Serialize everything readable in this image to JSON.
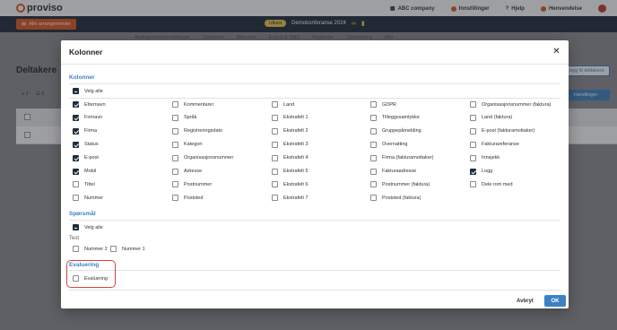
{
  "topbar": {
    "logo_text": "proviso",
    "company": "ABC company",
    "settings": "Innstillinger",
    "help": "Hjelp",
    "user": "Henvendelse"
  },
  "eventbar": {
    "all_events": "Alle arrangementer",
    "status": "Utkast",
    "event_name": "Demokonferanse 2024"
  },
  "tabs": [
    "Arrangementsinnstillinger",
    "Deltakere",
    "Økonomi",
    "E-post & SMS",
    "Rapporter",
    "Overnatting",
    "Mer"
  ],
  "page": {
    "title": "Deltakere",
    "add_button": "Legg til deltakere",
    "actions_button": "Handlinger",
    "filter_count": "1",
    "column_count": "0"
  },
  "modal": {
    "title": "Kolonner",
    "sections": {
      "columns": {
        "title": "Kolonner",
        "select_all": "Velg alle",
        "items": [
          {
            "label": "Etternavn",
            "checked": true
          },
          {
            "label": "Fornavn",
            "checked": true
          },
          {
            "label": "Firma",
            "checked": true
          },
          {
            "label": "Status",
            "checked": true
          },
          {
            "label": "E-post",
            "checked": true
          },
          {
            "label": "Mobil",
            "checked": true
          },
          {
            "label": "Tittel",
            "checked": false
          },
          {
            "label": "Nummer",
            "checked": false
          },
          {
            "label": "Kommentarer",
            "checked": false
          },
          {
            "label": "Språk",
            "checked": false
          },
          {
            "label": "Registreringsdato",
            "checked": false
          },
          {
            "label": "Kategori",
            "checked": false
          },
          {
            "label": "Organisasjonsnummer",
            "checked": false
          },
          {
            "label": "Adresse",
            "checked": false
          },
          {
            "label": "Postnummer",
            "checked": false
          },
          {
            "label": "Poststed",
            "checked": false
          },
          {
            "label": "Land",
            "checked": false
          },
          {
            "label": "Ekstrafelt 1",
            "checked": false
          },
          {
            "label": "Ekstrafelt 2",
            "checked": false
          },
          {
            "label": "Ekstrafelt 3",
            "checked": false
          },
          {
            "label": "Ekstrafelt 4",
            "checked": false
          },
          {
            "label": "Ekstrafelt 5",
            "checked": false
          },
          {
            "label": "Ekstrafelt 6",
            "checked": false
          },
          {
            "label": "Ekstrafelt 7",
            "checked": false
          },
          {
            "label": "GDPR",
            "checked": false
          },
          {
            "label": "Tilleggssamtykke",
            "checked": false
          },
          {
            "label": "Gruppepåmelding",
            "checked": false
          },
          {
            "label": "Overnatting",
            "checked": false
          },
          {
            "label": "Firma (fakturamottaker)",
            "checked": false
          },
          {
            "label": "Fakturaadresse",
            "checked": false
          },
          {
            "label": "Postnummer (faktura)",
            "checked": false
          },
          {
            "label": "Poststed (faktura)",
            "checked": false
          },
          {
            "label": "Organisasjonsnummer (faktura)",
            "checked": false
          },
          {
            "label": "Land (faktura)",
            "checked": false
          },
          {
            "label": "E-post (fakturamottaker)",
            "checked": false
          },
          {
            "label": "Fakturareferanse",
            "checked": false
          },
          {
            "label": "Innsjekk",
            "checked": false
          },
          {
            "label": "Logg",
            "checked": true
          },
          {
            "label": "Dele rom med",
            "checked": false
          }
        ]
      },
      "questions": {
        "title": "Spørsmål",
        "select_all": "Velg alle",
        "group_label": "Test",
        "items": [
          {
            "label": "Nummer 2",
            "checked": false
          },
          {
            "label": "Nummer 1",
            "checked": false
          }
        ]
      },
      "evaluation": {
        "title": "Evaluering",
        "items": [
          {
            "label": "Evaluering",
            "checked": false
          }
        ]
      }
    },
    "cancel_label": "Avbryt",
    "ok_label": "OK"
  },
  "colors": {
    "accent": "#3b82c4",
    "brand": "#e0541f",
    "navy": "#1d2a3a",
    "highlight": "#d9453d"
  }
}
